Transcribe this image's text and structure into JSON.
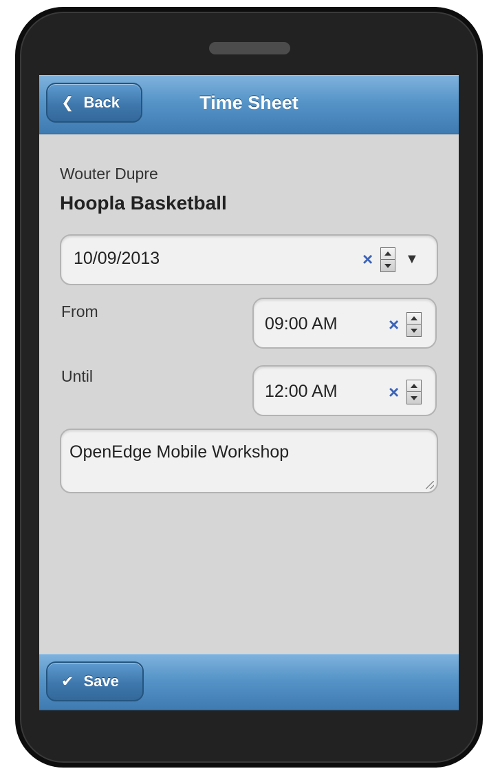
{
  "header": {
    "title": "Time Sheet",
    "back_label": "Back"
  },
  "form": {
    "person_name": "Wouter Dupre",
    "company": "Hoopla Basketball",
    "date_value": "10/09/2013",
    "from_label": "From",
    "from_value": "09:00 AM",
    "until_label": "Until",
    "until_value": "12:00 AM",
    "notes_value": "OpenEdge Mobile Workshop"
  },
  "footer": {
    "save_label": "Save"
  },
  "colors": {
    "header_blue": "#5694c8",
    "clear_x_blue": "#3b63b8",
    "screen_background": "#d6d6d6"
  },
  "icons": {
    "back": "chevron-left-icon",
    "save": "checkmark-icon",
    "clear": "clear-x-icon",
    "dropdown": "dropdown-arrow-icon"
  }
}
